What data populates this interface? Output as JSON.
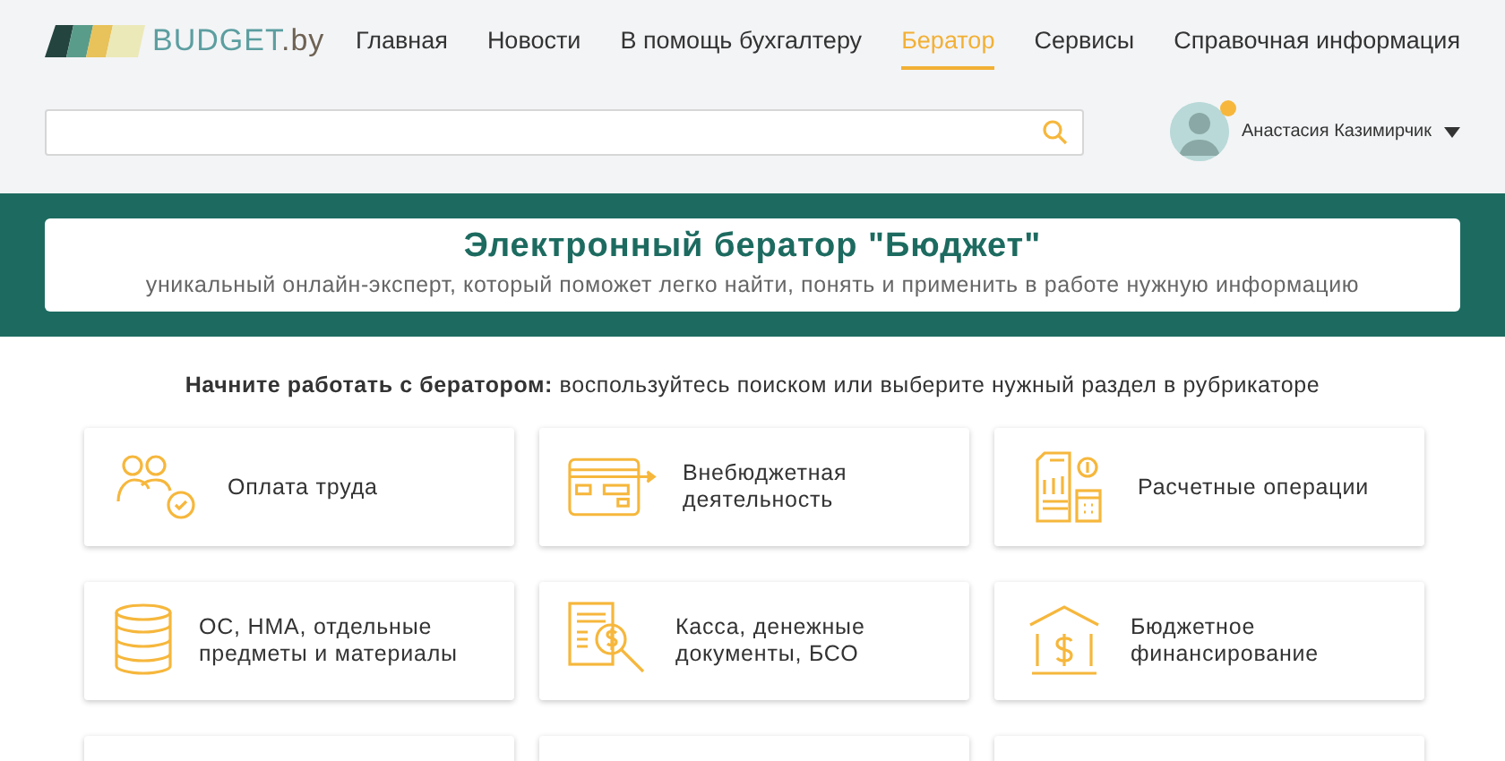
{
  "logo": {
    "name": "BUDGET",
    "suffix": ".by"
  },
  "nav": [
    {
      "label": "Главная",
      "selected": false
    },
    {
      "label": "Новости",
      "selected": false
    },
    {
      "label": "В помощь бухгалтеру",
      "selected": false
    },
    {
      "label": "Бератор",
      "selected": true
    },
    {
      "label": "Сервисы",
      "selected": false
    },
    {
      "label": "Справочная информация",
      "selected": false
    }
  ],
  "user": {
    "name": "Анастасия Казимирчик",
    "online": true
  },
  "hero": {
    "title": "Электронный бератор \"Бюджет\"",
    "subtitle": "уникальный онлайн-эксперт, который поможет легко найти, понять и применить в работе нужную информацию"
  },
  "intro": "**Начните работать с бератором:** воспользуйтесь поиском или выберите нужный раздел в рубрикаторе",
  "sections": [
    {
      "kind": "people",
      "label": "Оплата труда"
    },
    {
      "kind": "card",
      "label": "Внебюджетная деятельность"
    },
    {
      "kind": "report",
      "label": "Расчетные операции"
    },
    {
      "kind": "coins",
      "label": "ОС, НМА, отдельные предметы и материалы"
    },
    {
      "kind": "magnifier",
      "label": "Касса, денежные документы, БСО"
    },
    {
      "kind": "house",
      "label": "Бюджетное финансирование"
    },
    {
      "kind": "partial"
    },
    {
      "kind": "partial"
    },
    {
      "kind": "partial"
    }
  ]
}
